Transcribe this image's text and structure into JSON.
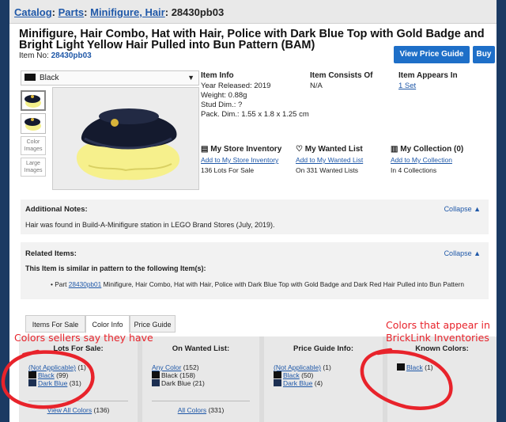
{
  "breadcrumb": {
    "catalog": "Catalog",
    "parts": "Parts",
    "minifigure_hair": "Minifigure, Hair",
    "item": "28430pb03"
  },
  "title": "Minifigure, Hair Combo, Hat with Hair, Police with Dark Blue Top with Gold Badge and Bright Light Yellow Hair Pulled into Bun Pattern (BAM)",
  "item_no_label": "Item No:",
  "item_no": "28430pb03",
  "buttons": {
    "price_guide": "View Price Guide",
    "buy": "Buy"
  },
  "color_select": {
    "value": "Black",
    "caret": "▼"
  },
  "thumbs": {
    "color_images": "Color Images",
    "large_images": "Large Images"
  },
  "item_info": {
    "heading": "Item Info",
    "year": "Year Released: 2019",
    "weight": "Weight: 0.88g",
    "stud": "Stud Dim.: ?",
    "pack": "Pack. Dim.: 1.55 x 1.8 x 1.25 cm"
  },
  "consists_of": {
    "heading": "Item Consists Of",
    "value": "N/A"
  },
  "appears_in": {
    "heading": "Item Appears In",
    "value": "1 Set"
  },
  "store": {
    "heading": "My Store Inventory",
    "link": "Add to My Store Inventory",
    "detail": "136 Lots For Sale"
  },
  "wanted": {
    "heading": "My Wanted List",
    "link": "Add to My Wanted List",
    "detail": "On 331 Wanted Lists"
  },
  "collection": {
    "heading": "My Collection (0)",
    "link": "Add to My Collection",
    "detail": "In 4 Collections"
  },
  "notes": {
    "heading": "Additional Notes:",
    "collapse": "Collapse ▲",
    "body": "Hair was found in Build-A-Minifigure station in LEGO Brand Stores (July, 2019)."
  },
  "related": {
    "heading": "Related Items:",
    "collapse": "Collapse ▲",
    "sub": "This Item is similar in pattern to the following Item(s):",
    "bullet_prefix": "• Part",
    "bullet_link": "28430pb01",
    "bullet_text": "Minifigure, Hair Combo, Hat with Hair, Police with Dark Blue Top with Gold Badge and Dark Red Hair Pulled into Bun Pattern"
  },
  "tabs": [
    "Items For Sale",
    "Color Info",
    "Price Guide"
  ],
  "columns": {
    "lots_for_sale": {
      "heading": "Lots For Sale:",
      "na": "(Not Applicable)",
      "na_count": "(1)",
      "black": "Black",
      "black_count": "(99)",
      "dark_blue": "Dark Blue",
      "dark_blue_count": "(31)",
      "bottom": "View All Colors",
      "bottom_count": "(136)"
    },
    "wanted_list": {
      "heading": "On Wanted List:",
      "any": "Any Color",
      "any_count": "(152)",
      "black": "Black",
      "black_count": "(158)",
      "dark_blue": "Dark Blue",
      "dark_blue_count": "(21)",
      "bottom": "All Colors",
      "bottom_count": "(331)"
    },
    "price_guide": {
      "heading": "Price Guide Info:",
      "na": "(Not Applicable)",
      "na_count": "(1)",
      "black": "Black",
      "black_count": "(50)",
      "dark_blue": "Dark Blue",
      "dark_blue_count": "(4)"
    },
    "known_colors": {
      "heading": "Known Colors:",
      "black": "Black",
      "black_count": "(1)"
    }
  },
  "annotations": {
    "left": "Colors sellers say they have",
    "right_line1": "Colors that appear in",
    "right_line2": "BrickLink Inventories"
  },
  "colors": {
    "link": "#1f58a8",
    "button": "#1e6fc8",
    "annotation": "#e8232b",
    "frame_bg": "#1b3a63",
    "dark_blue_swatch": "#1c2f52"
  },
  "icons": [
    "store-icon",
    "heart-icon",
    "collection-icon",
    "caret-down-icon"
  ]
}
